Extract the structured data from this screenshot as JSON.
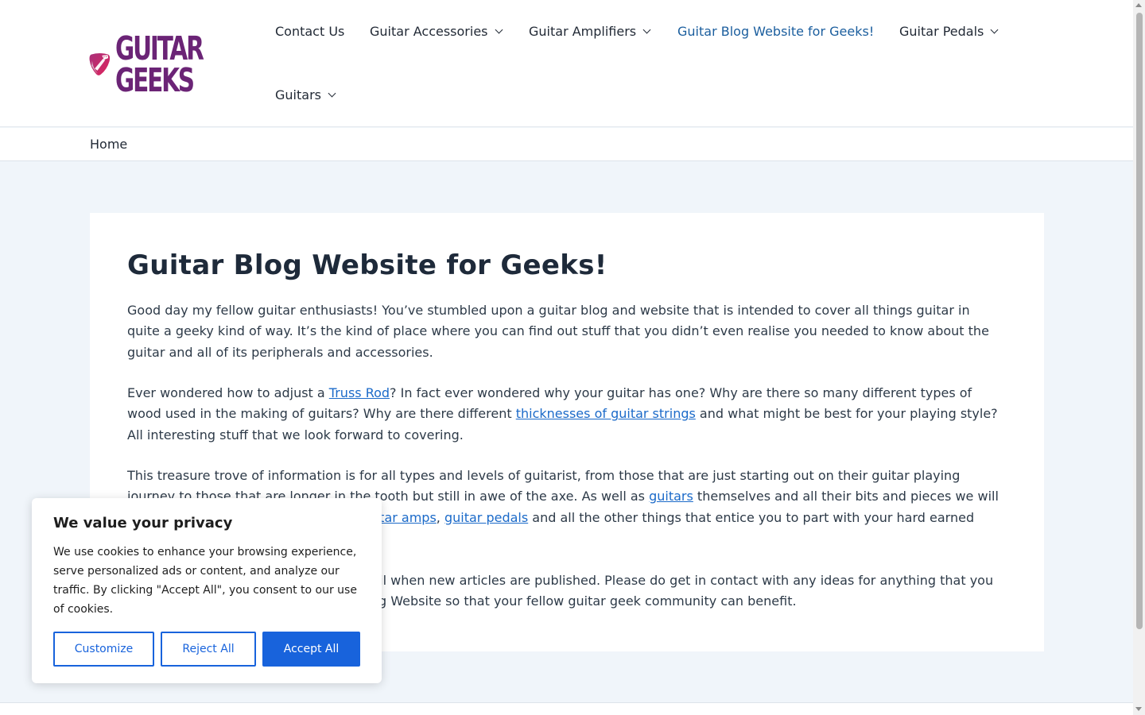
{
  "header": {
    "logo_lines": [
      "GUITAR",
      "GEEKS"
    ],
    "nav": [
      {
        "label": "Contact Us",
        "has_dropdown": false,
        "active": false
      },
      {
        "label": "Guitar Accessories",
        "has_dropdown": true,
        "active": false
      },
      {
        "label": "Guitar Amplifiers",
        "has_dropdown": true,
        "active": false
      },
      {
        "label": "Guitar Blog Website for Geeks!",
        "has_dropdown": false,
        "active": true
      },
      {
        "label": "Guitar Pedals",
        "has_dropdown": true,
        "active": false
      },
      {
        "label": "Guitars",
        "has_dropdown": true,
        "active": false
      }
    ]
  },
  "breadcrumb": {
    "home": "Home"
  },
  "article": {
    "title": "Guitar Blog Website for Geeks!",
    "p1": "Good day my fellow guitar enthusiasts! You’ve stumbled upon a guitar blog and website that is intended to cover all things guitar in quite a geeky kind of way. It’s the kind of place where you can find out stuff that you didn’t even realise you needed to know about the guitar and all of its peripherals and accessories.",
    "p2_a": "Ever wondered how to adjust a ",
    "p2_link1": "Truss Rod",
    "p2_b": "? In fact ever wondered why your guitar has one? Why are there so many different types of wood used in the making of guitars? Why are there different ",
    "p2_link2": "thicknesses of guitar strings",
    "p2_c": " and what might be best for your playing style? All interesting stuff that we look forward to covering.",
    "p3_a": "This treasure trove of information is for all types and levels of guitarist, from those that are just starting out on their guitar playing journey to those that are longer in the tooth but still in awe of the axe. As well as ",
    "p3_link1": "guitars",
    "p3_b": " themselves and all their bits and pieces we will also be covering guitar accessories",
    "p3_c": ", ",
    "p3_link3": "guitar amps",
    "p3_d": ", ",
    "p3_link4": "guitar pedals",
    "p3_e": " and all the other things that entice you to part with your hard earned cash.",
    "p4": "Please subscribe to get notified by email when new articles are published. Please do get in contact with any ideas for anything that you would like us to cover on our Guitar Blog Website so that your fellow guitar geek community can benefit."
  },
  "cookie_banner": {
    "title": "We value your privacy",
    "text": "We use cookies to enhance your browsing experience, serve personalized ads or content, and analyze our traffic. By clicking \"Accept All\", you consent to our use of cookies.",
    "customize_label": "Customize",
    "reject_label": "Reject All",
    "accept_label": "Accept All"
  },
  "colors": {
    "accent": "#1863dc",
    "link": "#1b6ac9",
    "logo_purple": "#6b2476",
    "logo_pink": "#c7285f",
    "background": "#f0f5fa"
  },
  "icons": {
    "logo": "guitar-pick-icon",
    "dropdown": "chevron-down-icon"
  }
}
